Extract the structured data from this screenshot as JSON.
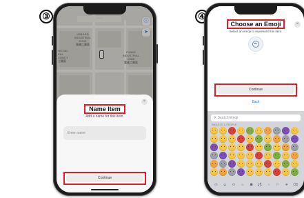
{
  "steps": [
    "③",
    "④"
  ],
  "phone1": {
    "map_labels": [
      "USAKKO\nINDUSTRIAL\nZONE\n烏橋工業區",
      "HOTIAL\nEAL\nZONE 3\n工業區",
      "FUNKE\nINDUSTRIAL\nZONE\n富基工業區",
      "XIAPING"
    ],
    "dialog": {
      "title": "Name Item",
      "subtitle": "Add a name for this item.",
      "input_placeholder": "Enter name",
      "continue_label": "Continue",
      "close_glyph": "×"
    }
  },
  "phone2": {
    "dialog": {
      "title": "Choose an Emoji",
      "subtitle": "Select an emoji to represent this item.",
      "continue_label": "Continue",
      "back_label": "Back",
      "close_glyph": "×"
    },
    "keyboard": {
      "search_placeholder": "Search Emoji",
      "category_label": "SMILEYS & PEOPLE",
      "tab_icons": [
        "◷",
        "☺",
        "⊙",
        "♨",
        "☗",
        "⚽",
        "♀",
        "⚐",
        "⎈",
        "⌫"
      ]
    }
  },
  "colors": {
    "highlight": "#e11d2a",
    "link": "#2e7cf6",
    "emoji_yellow": "#f6c542",
    "emoji_orange": "#f2a33a",
    "emoji_red": "#d9413a",
    "emoji_purple": "#7b4fb5",
    "emoji_green": "#7fb03f",
    "emoji_grey": "#9aa0a6"
  }
}
